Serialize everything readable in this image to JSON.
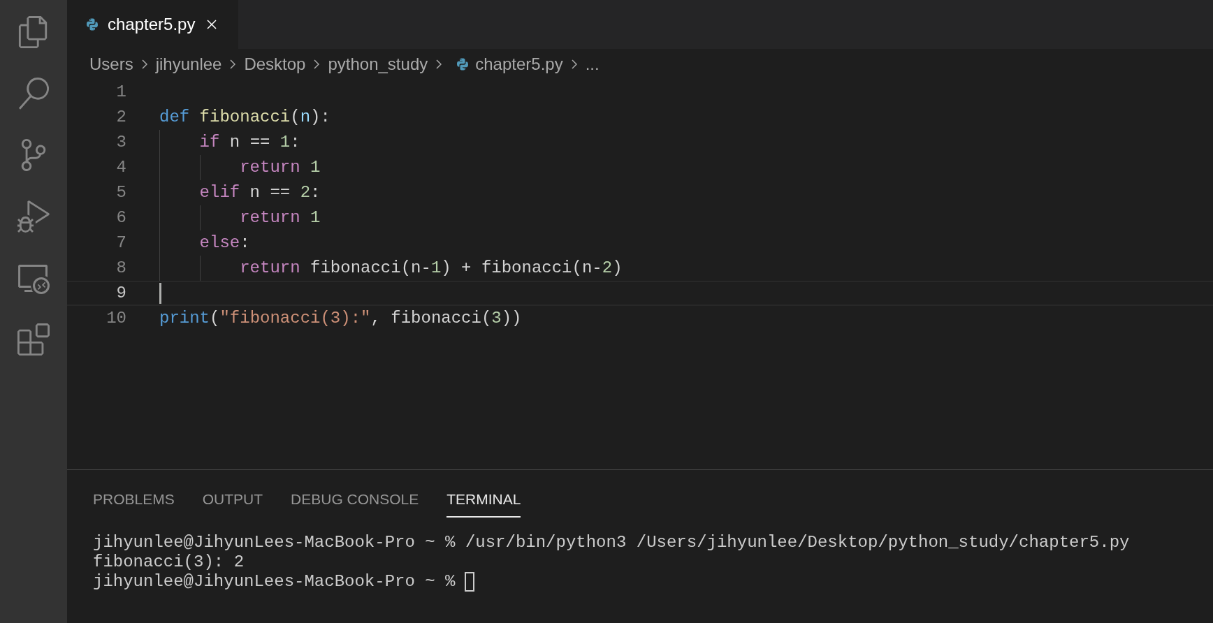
{
  "activity_bar": [
    {
      "kind": "files",
      "selected": false
    },
    {
      "kind": "search",
      "selected": false
    },
    {
      "kind": "source-control",
      "selected": false
    },
    {
      "kind": "run-debug",
      "selected": false
    },
    {
      "kind": "remote",
      "selected": false
    },
    {
      "kind": "extensions",
      "selected": false
    }
  ],
  "tabs": [
    {
      "label": "chapter5.py",
      "selected": true
    }
  ],
  "breadcrumbs": [
    {
      "label": "Users",
      "kind": "folder"
    },
    {
      "label": "jihyunlee",
      "kind": "folder"
    },
    {
      "label": "Desktop",
      "kind": "folder"
    },
    {
      "label": "python_study",
      "kind": "folder"
    },
    {
      "label": "chapter5.py",
      "kind": "python-file"
    },
    {
      "label": "...",
      "kind": "more"
    }
  ],
  "code": [
    {
      "number": "1",
      "current": false
    },
    {
      "number": "2",
      "current": false,
      "tokens": [
        {
          "text": "def",
          "kind": "keyword"
        },
        {
          "text": " fibonacci",
          "kind": "function"
        },
        {
          "text": "(",
          "kind": "plain"
        },
        {
          "text": "n",
          "kind": "param"
        },
        {
          "text": "):",
          "kind": "plain"
        }
      ]
    },
    {
      "number": "3",
      "current": false,
      "tokens": [
        {
          "text": "    if",
          "kind": "control"
        },
        {
          "text": " n == ",
          "kind": "plain"
        },
        {
          "text": "1",
          "kind": "number"
        },
        {
          "text": ":",
          "kind": "plain"
        }
      ]
    },
    {
      "number": "4",
      "current": false,
      "tokens": [
        {
          "text": "        return",
          "kind": "control"
        },
        {
          "text": " 1",
          "kind": "number"
        }
      ]
    },
    {
      "number": "5",
      "current": false,
      "tokens": [
        {
          "text": "    elif",
          "kind": "control"
        },
        {
          "text": " n == ",
          "kind": "plain"
        },
        {
          "text": "2",
          "kind": "number"
        },
        {
          "text": ":",
          "kind": "plain"
        }
      ]
    },
    {
      "number": "6",
      "current": false,
      "tokens": [
        {
          "text": "        return",
          "kind": "control"
        },
        {
          "text": " 1",
          "kind": "number"
        }
      ]
    },
    {
      "number": "7",
      "current": false,
      "tokens": [
        {
          "text": "    else",
          "kind": "control"
        },
        {
          "text": ":",
          "kind": "plain"
        }
      ]
    },
    {
      "number": "8",
      "current": false,
      "tokens": [
        {
          "text": "        return",
          "kind": "control"
        },
        {
          "text": " fibonacci(n-",
          "kind": "plain"
        },
        {
          "text": "1",
          "kind": "number"
        },
        {
          "text": ") + fibonacci(n-",
          "kind": "plain"
        },
        {
          "text": "2",
          "kind": "number"
        },
        {
          "text": ")",
          "kind": "plain"
        }
      ]
    },
    {
      "number": "9",
      "current": true
    },
    {
      "number": "10",
      "current": false,
      "tokens": [
        {
          "text": "print",
          "kind": "builtin"
        },
        {
          "text": "(",
          "kind": "plain"
        },
        {
          "text": "\"fibonacci(3):\"",
          "kind": "string"
        },
        {
          "text": ", fibonacci(",
          "kind": "plain"
        },
        {
          "text": "3",
          "kind": "number"
        },
        {
          "text": "))",
          "kind": "plain"
        }
      ]
    }
  ],
  "panel": {
    "tabs": [
      {
        "label": "PROBLEMS",
        "selected": false
      },
      {
        "label": "OUTPUT",
        "selected": false
      },
      {
        "label": "DEBUG CONSOLE",
        "selected": false
      },
      {
        "label": "TERMINAL",
        "selected": true
      }
    ],
    "terminal": [
      {
        "text": "jihyunlee@JihyunLees-MacBook-Pro ~ % /usr/bin/python3 /Users/jihyunlee/Desktop/python_study/chapter5.py",
        "cursor": false
      },
      {
        "text": "fibonacci(3): 2",
        "cursor": false
      },
      {
        "text": "jihyunlee@JihyunLees-MacBook-Pro ~ %",
        "cursor": true
      }
    ]
  }
}
